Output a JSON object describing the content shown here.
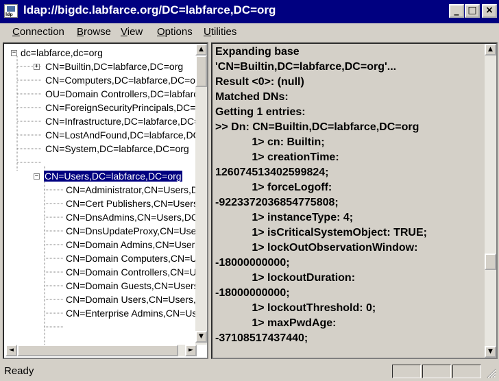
{
  "window": {
    "title": "ldap://bigdc.labfarce.org/DC=labfarce,DC=org",
    "app_icon_text": "ldp",
    "minimize": "_",
    "maximize": "□",
    "close": "×"
  },
  "menu": [
    "Connection",
    "Browse",
    "View",
    "Options",
    "Utilities"
  ],
  "tree": {
    "items": [
      {
        "label": "dc=labfarce,dc=org",
        "toggle": "−"
      },
      {
        "label": "CN=Builtin,DC=labfarce,DC=org",
        "toggle": "+"
      },
      {
        "label": "CN=Computers,DC=labfarce,DC=org"
      },
      {
        "label": "OU=Domain Controllers,DC=labfarce,DC=org"
      },
      {
        "label": "CN=ForeignSecurityPrincipals,DC=labfarce,DC=org"
      },
      {
        "label": "CN=Infrastructure,DC=labfarce,DC=org"
      },
      {
        "label": "CN=LostAndFound,DC=labfarce,DC=org"
      },
      {
        "label": "CN=System,DC=labfarce,DC=org"
      },
      {
        "label": "CN=Users,DC=labfarce,DC=org",
        "toggle": "−"
      },
      {
        "label": "CN=Administrator,CN=Users,DC=labfarce,DC=org"
      },
      {
        "label": "CN=Cert Publishers,CN=Users,DC=labfarce,DC=org"
      },
      {
        "label": "CN=DnsAdmins,CN=Users,DC=labfarce,DC=org"
      },
      {
        "label": "CN=DnsUpdateProxy,CN=Users,DC=labfarce,DC=org"
      },
      {
        "label": "CN=Domain Admins,CN=Users,DC=labfarce,DC=org"
      },
      {
        "label": "CN=Domain Computers,CN=Users,DC=labfarce,DC=org"
      },
      {
        "label": "CN=Domain Controllers,CN=Users,DC=labfarce,DC=org"
      },
      {
        "label": "CN=Domain Guests,CN=Users,DC=labfarce,DC=org"
      },
      {
        "label": "CN=Domain Users,CN=Users,DC=labfarce,DC=org"
      },
      {
        "label": "CN=Enterprise Admins,CN=Users,DC=labfarce,DC=org"
      }
    ],
    "selected_label": "CN=Users,DC=labfarce,DC=org"
  },
  "scroll_arrows": {
    "up": "▲",
    "down": "▼",
    "left": "◄",
    "right": "►"
  },
  "output": {
    "lines": [
      "Expanding base",
      "'CN=Builtin,DC=labfarce,DC=org'...",
      "Result <0>: (null)",
      "Matched DNs:",
      "Getting 1 entries:",
      ">> Dn: CN=Builtin,DC=labfarce,DC=org",
      "            1> cn: Builtin;",
      "            1> creationTime:",
      "126074513402599824;",
      "            1> forceLogoff:",
      "-9223372036854775808;",
      "            1> instanceType: 4;",
      "            1> isCriticalSystemObject: TRUE;",
      "            1> lockOutObservationWindow:",
      "-18000000000;",
      "            1> lockoutDuration:",
      "-18000000000;",
      "            1> lockoutThreshold: 0;",
      "            1> maxPwdAge:",
      "-37108517437440;"
    ]
  },
  "status": {
    "text": "Ready"
  }
}
